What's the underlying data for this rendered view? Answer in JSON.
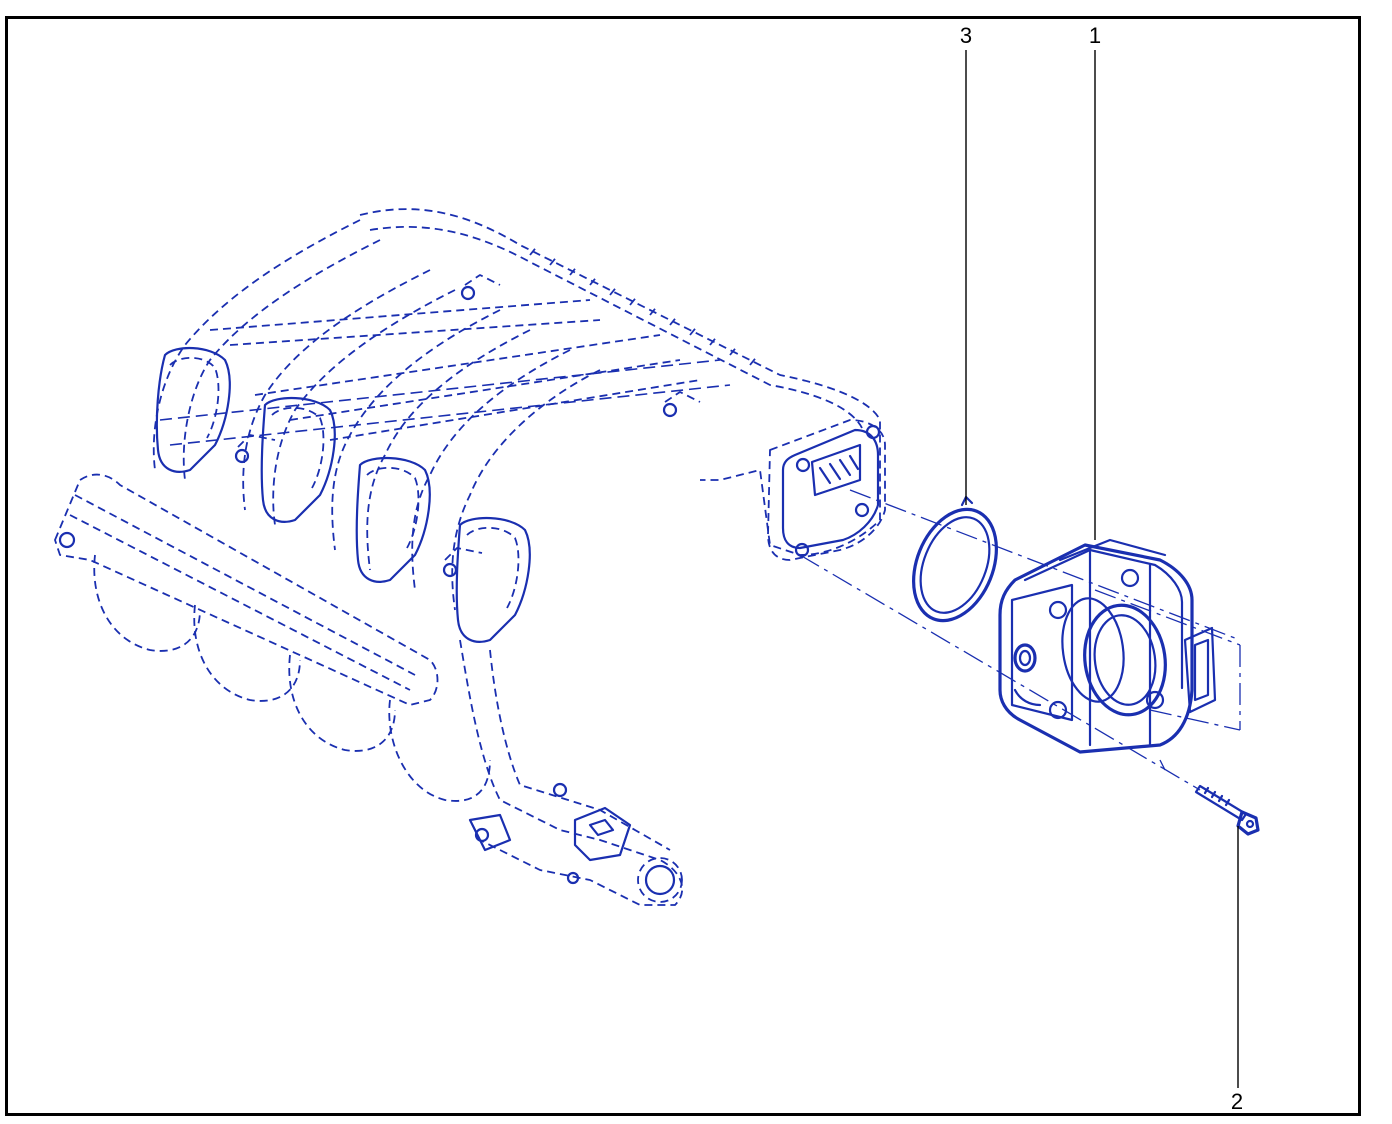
{
  "callouts": {
    "item_1": "1",
    "item_2": "2",
    "item_3": "3"
  },
  "colors": {
    "line": "#1a2fb0",
    "frame": "#000000",
    "background": "#ffffff"
  }
}
